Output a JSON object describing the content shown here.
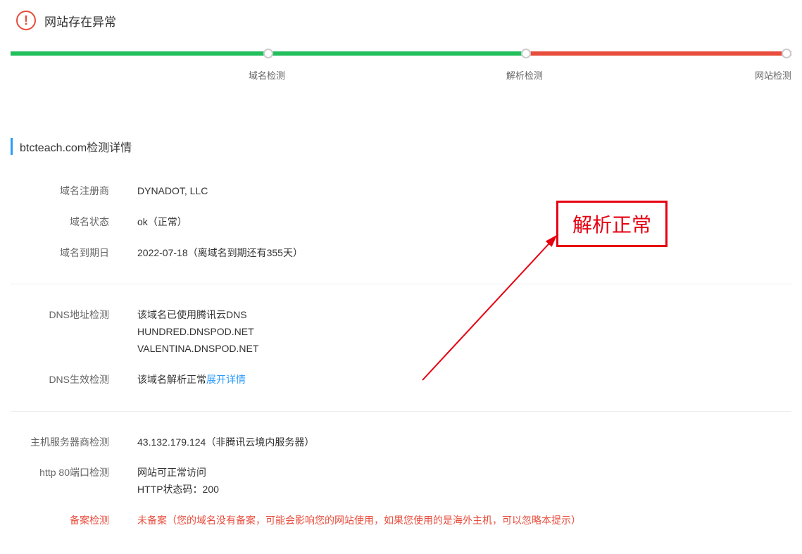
{
  "header": {
    "title": "网站存在异常"
  },
  "progress": {
    "step1_label": "域名检测",
    "step2_label": "解析检测",
    "step3_label": "网站检测"
  },
  "section_title": "btcteach.com检测详情",
  "details": {
    "registrar_label": "域名注册商",
    "registrar_value": "DYNADOT, LLC",
    "status_label": "域名状态",
    "status_value": "ok（正常）",
    "expiry_label": "域名到期日",
    "expiry_value": "2022-07-18（离域名到期还有355天）",
    "dns_addr_label": "DNS地址检测",
    "dns_addr_line1": "该域名已使用腾讯云DNS",
    "dns_addr_line2": "HUNDRED.DNSPOD.NET",
    "dns_addr_line3": "VALENTINA.DNSPOD.NET",
    "dns_effect_label": "DNS生效检测",
    "dns_effect_text": "该域名解析正常",
    "dns_effect_link": "展开详情",
    "host_label": "主机服务器商检测",
    "host_value": "43.132.179.124（非腾讯云境内服务器）",
    "http_label": "http 80端口检测",
    "http_line1": "网站可正常访问",
    "http_line2": "HTTP状态码：200",
    "beian_label": "备案检测",
    "beian_value": "未备案（您的域名没有备案，可能会影响您的网站使用，如果您使用的是海外主机，可以忽略本提示）"
  },
  "annotation": {
    "text": "解析正常"
  }
}
